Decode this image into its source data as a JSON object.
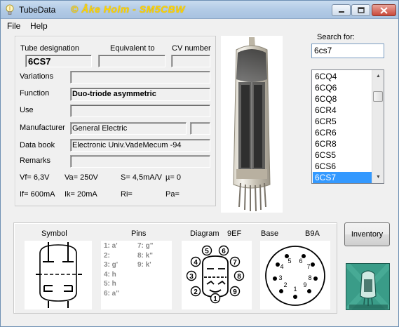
{
  "window": {
    "title": "TubeData",
    "credit": "© Åke Holm - SM5CBW"
  },
  "menu": {
    "file_label": "File",
    "help_label": "Help"
  },
  "tube": {
    "designation_label": "Tube designation",
    "designation": "6CS7",
    "equivalent_label": "Equivalent to",
    "equivalent": "",
    "cv_label": "CV number",
    "cv": "",
    "variations_label": "Variations",
    "variations": "",
    "function_label": "Function",
    "function": "Duo-triode asymmetric",
    "use_label": "Use",
    "use": "",
    "manufacturer_label": "Manufacturer",
    "manufacturer": "General Electric",
    "manufacturer_extra": "",
    "databook_label": "Data book",
    "databook": "Electronic Univ.VadeMecum -94",
    "remarks_label": "Remarks",
    "remarks": ""
  },
  "specs": {
    "vf": "Vf= 6,3V",
    "va": "Va=  250V",
    "s": "S= 4,5mA/V",
    "mu": "µ=    0",
    "if": "If= 600mA",
    "ik": "Ik=  20mA",
    "ri": "Ri=",
    "pa": "Pa="
  },
  "search": {
    "label": "Search for:",
    "value": "6cs7"
  },
  "tube_list": {
    "items": [
      "6CQ4",
      "6CQ6",
      "6CQ8",
      "6CR4",
      "6CR5",
      "6CR6",
      "6CR8",
      "6CS5",
      "6CS6",
      "6CS7"
    ],
    "selected": "6CS7"
  },
  "bottom": {
    "symbol_label": "Symbol",
    "pins_label": "Pins",
    "diagram_label": "Diagram",
    "diagram_code": "9EF",
    "base_label": "Base",
    "base_code": "B9A",
    "pins_left": [
      "1: a'",
      "2:",
      "3: g'",
      "4: h",
      "5: h",
      "6: a\""
    ],
    "pins_right": [
      "7: g\"",
      "8: k\"",
      "9: k'"
    ],
    "diagram_pins": [
      "1",
      "2",
      "3",
      "4",
      "5",
      "6",
      "7",
      "8",
      "9"
    ],
    "base_pins": [
      "1",
      "2",
      "3",
      "4",
      "5",
      "6",
      "7",
      "8",
      "9"
    ]
  },
  "inventory_label": "Inventory",
  "icons": {
    "app": "lightbulb-icon",
    "minimize": "minimize-icon",
    "maximize": "maximize-icon",
    "close": "close-icon",
    "scroll_up": "scroll-up-icon",
    "scroll_down": "scroll-down-icon"
  },
  "colors": {
    "credit": "#ffd400",
    "selection": "#3399ff",
    "close_button": "#c9483a"
  }
}
